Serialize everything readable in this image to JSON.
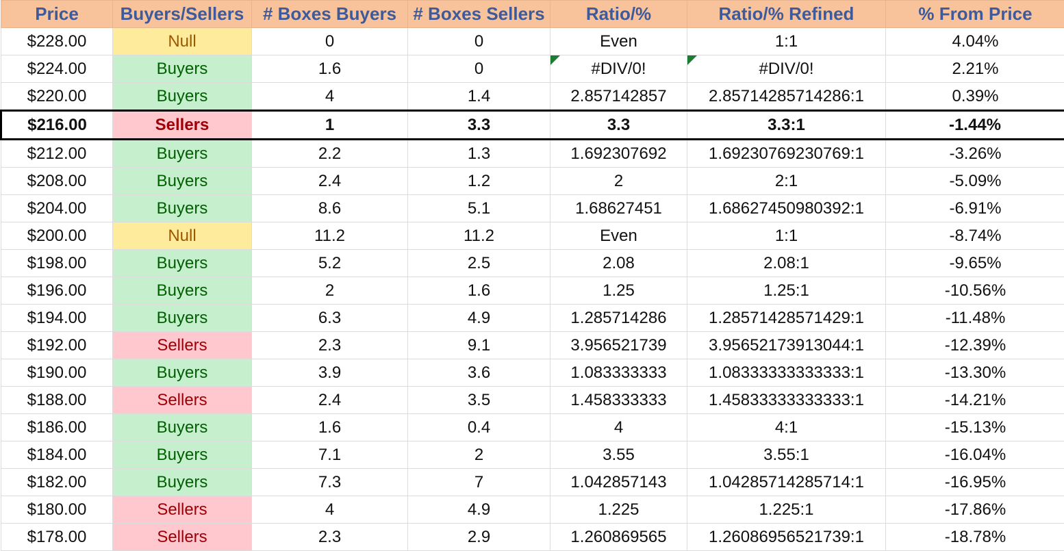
{
  "headers": [
    "Price",
    "Buyers/Sellers",
    "# Boxes Buyers",
    "# Boxes Sellers",
    "Ratio/%",
    "Ratio/% Refined",
    "% From Price"
  ],
  "colors": {
    "header_bg": "#f8c39b",
    "header_text": "#3e5a9a",
    "buyers_bg": "#c6efce",
    "buyers_text": "#006100",
    "sellers_bg": "#ffc7ce",
    "sellers_text": "#9c0006",
    "null_bg": "#ffeb9c",
    "null_text": "#9c5700",
    "error_flag": "#1e7b34"
  },
  "rows": [
    {
      "price": "$228.00",
      "side": "Null",
      "buyers": "0",
      "sellers": "0",
      "ratio": "Even",
      "refined": "1:1",
      "from_price": "4.04%"
    },
    {
      "price": "$224.00",
      "side": "Buyers",
      "buyers": "1.6",
      "sellers": "0",
      "ratio": "#DIV/0!",
      "refined": "#DIV/0!",
      "from_price": "2.21%",
      "error": true
    },
    {
      "price": "$220.00",
      "side": "Buyers",
      "buyers": "4",
      "sellers": "1.4",
      "ratio": "2.857142857",
      "refined": "2.85714285714286:1",
      "from_price": "0.39%"
    },
    {
      "price": "$216.00",
      "side": "Sellers",
      "buyers": "1",
      "sellers": "3.3",
      "ratio": "3.3",
      "refined": "3.3:1",
      "from_price": "-1.44%",
      "highlight": true
    },
    {
      "price": "$212.00",
      "side": "Buyers",
      "buyers": "2.2",
      "sellers": "1.3",
      "ratio": "1.692307692",
      "refined": "1.69230769230769:1",
      "from_price": "-3.26%"
    },
    {
      "price": "$208.00",
      "side": "Buyers",
      "buyers": "2.4",
      "sellers": "1.2",
      "ratio": "2",
      "refined": "2:1",
      "from_price": "-5.09%"
    },
    {
      "price": "$204.00",
      "side": "Buyers",
      "buyers": "8.6",
      "sellers": "5.1",
      "ratio": "1.68627451",
      "refined": "1.68627450980392:1",
      "from_price": "-6.91%"
    },
    {
      "price": "$200.00",
      "side": "Null",
      "buyers": "11.2",
      "sellers": "11.2",
      "ratio": "Even",
      "refined": "1:1",
      "from_price": "-8.74%"
    },
    {
      "price": "$198.00",
      "side": "Buyers",
      "buyers": "5.2",
      "sellers": "2.5",
      "ratio": "2.08",
      "refined": "2.08:1",
      "from_price": "-9.65%"
    },
    {
      "price": "$196.00",
      "side": "Buyers",
      "buyers": "2",
      "sellers": "1.6",
      "ratio": "1.25",
      "refined": "1.25:1",
      "from_price": "-10.56%"
    },
    {
      "price": "$194.00",
      "side": "Buyers",
      "buyers": "6.3",
      "sellers": "4.9",
      "ratio": "1.285714286",
      "refined": "1.28571428571429:1",
      "from_price": "-11.48%"
    },
    {
      "price": "$192.00",
      "side": "Sellers",
      "buyers": "2.3",
      "sellers": "9.1",
      "ratio": "3.956521739",
      "refined": "3.95652173913044:1",
      "from_price": "-12.39%"
    },
    {
      "price": "$190.00",
      "side": "Buyers",
      "buyers": "3.9",
      "sellers": "3.6",
      "ratio": "1.083333333",
      "refined": "1.08333333333333:1",
      "from_price": "-13.30%"
    },
    {
      "price": "$188.00",
      "side": "Sellers",
      "buyers": "2.4",
      "sellers": "3.5",
      "ratio": "1.458333333",
      "refined": "1.45833333333333:1",
      "from_price": "-14.21%"
    },
    {
      "price": "$186.00",
      "side": "Buyers",
      "buyers": "1.6",
      "sellers": "0.4",
      "ratio": "4",
      "refined": "4:1",
      "from_price": "-15.13%"
    },
    {
      "price": "$184.00",
      "side": "Buyers",
      "buyers": "7.1",
      "sellers": "2",
      "ratio": "3.55",
      "refined": "3.55:1",
      "from_price": "-16.04%"
    },
    {
      "price": "$182.00",
      "side": "Buyers",
      "buyers": "7.3",
      "sellers": "7",
      "ratio": "1.042857143",
      "refined": "1.04285714285714:1",
      "from_price": "-16.95%"
    },
    {
      "price": "$180.00",
      "side": "Sellers",
      "buyers": "4",
      "sellers": "4.9",
      "ratio": "1.225",
      "refined": "1.225:1",
      "from_price": "-17.86%"
    },
    {
      "price": "$178.00",
      "side": "Sellers",
      "buyers": "2.3",
      "sellers": "2.9",
      "ratio": "1.260869565",
      "refined": "1.26086956521739:1",
      "from_price": "-18.78%"
    }
  ]
}
